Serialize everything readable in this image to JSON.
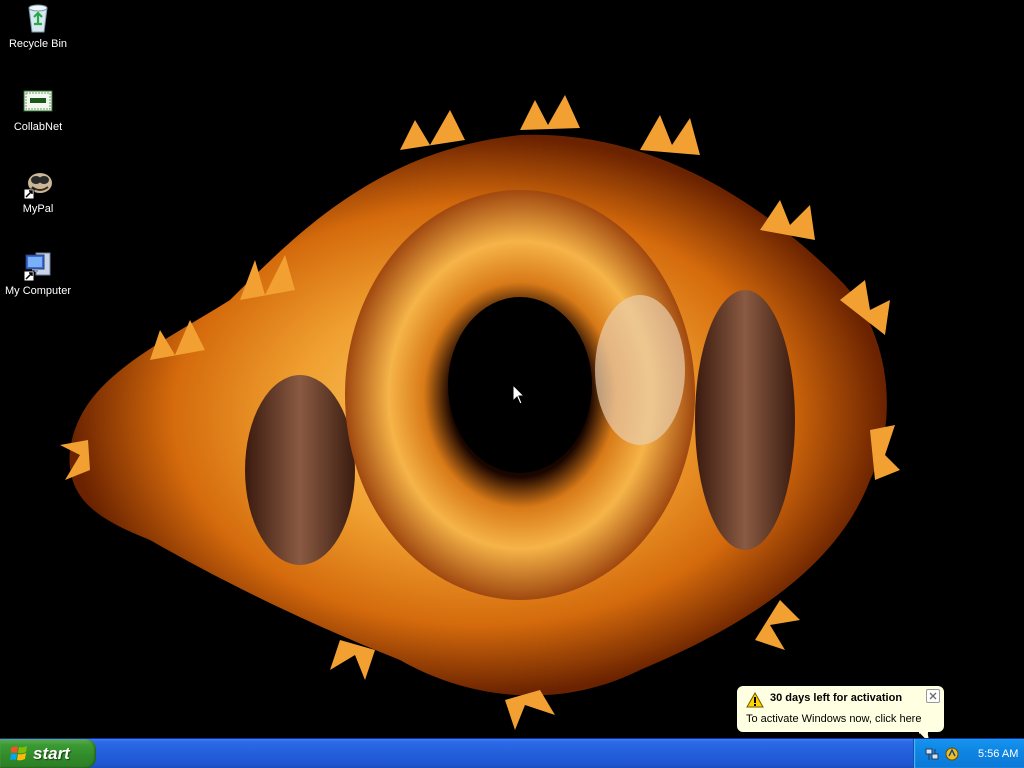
{
  "desktop": {
    "icons": [
      {
        "label": "Recycle Bin",
        "icon": "recycle-bin-icon"
      },
      {
        "label": "CollabNet",
        "icon": "collabnet-icon"
      },
      {
        "label": "MyPal",
        "icon": "mypal-icon"
      },
      {
        "label": "My Computer",
        "icon": "my-computer-icon"
      }
    ],
    "background_color": "#000000",
    "wallpaper": "flaming-eye-wallpaper"
  },
  "taskbar": {
    "start_label": "start",
    "clock": "5:56 AM",
    "tray_icons": [
      "network-icon",
      "windows-activation-icon"
    ]
  },
  "balloon": {
    "title": "30 days left for activation",
    "text": "To activate Windows now, click here",
    "icon": "warning-icon",
    "background": "#ffffe1"
  },
  "colors": {
    "taskbar_blue": "#245edb",
    "start_green": "#3c9b35",
    "tray_blue": "#0f86e4"
  }
}
